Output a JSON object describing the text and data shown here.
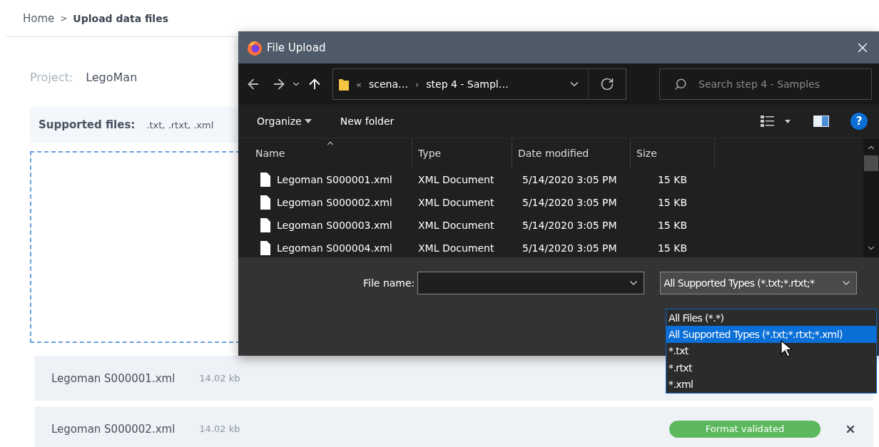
{
  "breadcrumb": {
    "parent": "Home",
    "separator": ">",
    "current": "Upload data files"
  },
  "project": {
    "label": "Project:",
    "value": "LegoMan"
  },
  "supported": {
    "label": "Supported files:",
    "value": ".txt, .rtxt, .xml"
  },
  "uploads": [
    {
      "name": "Legoman S000001.xml",
      "size": "14.02 kb"
    },
    {
      "name": "Legoman S000002.xml",
      "size": "14.02 kb",
      "status": "Format validated",
      "removable": true
    }
  ],
  "dialog": {
    "title": "File Upload",
    "path": {
      "prefix": "«",
      "parts": [
        "scena…",
        "step 4 - Sampl…"
      ],
      "separator": "›"
    },
    "search_placeholder": "Search step 4 - Samples",
    "toolbar": {
      "organize": "Organize",
      "new_folder": "New folder",
      "help": "?"
    },
    "columns": [
      "Name",
      "Type",
      "Date modified",
      "Size"
    ],
    "files": [
      {
        "name": "Legoman S000001.xml",
        "type": "XML Document",
        "date": "5/14/2020 3:05 PM",
        "size": "15 KB"
      },
      {
        "name": "Legoman S000002.xml",
        "type": "XML Document",
        "date": "5/14/2020 3:05 PM",
        "size": "15 KB"
      },
      {
        "name": "Legoman S000003.xml",
        "type": "XML Document",
        "date": "5/14/2020 3:05 PM",
        "size": "15 KB"
      },
      {
        "name": "Legoman S000004.xml",
        "type": "XML Document",
        "date": "5/14/2020 3:05 PM",
        "size": "15 KB"
      }
    ],
    "file_name_label": "File name:",
    "file_type_value": "All Supported Types (*.txt;*.rtxt;*",
    "file_type_options": [
      {
        "label": "All Files (*.*)",
        "selected": false
      },
      {
        "label": "All Supported Types (*.txt;*.rtxt;*.xml)",
        "selected": true
      },
      {
        "label": "*.txt",
        "selected": false
      },
      {
        "label": "*.rtxt",
        "selected": false
      },
      {
        "label": "*.xml",
        "selected": false
      }
    ]
  }
}
